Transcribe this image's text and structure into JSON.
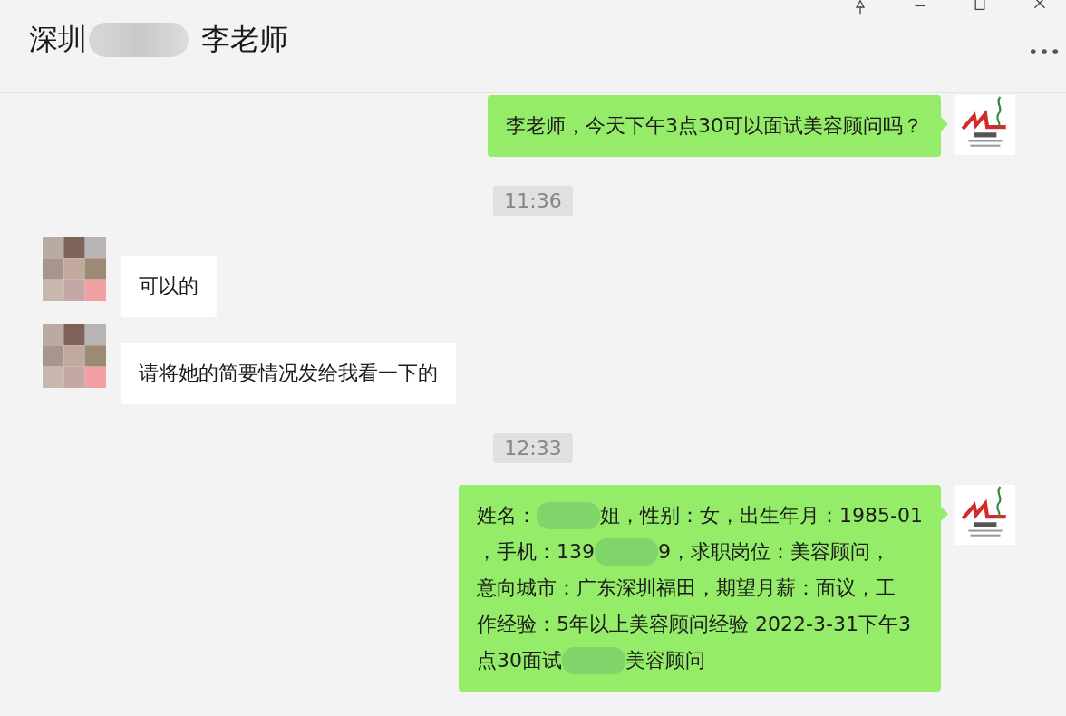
{
  "window": {
    "title_parts": [
      {
        "kind": "text",
        "text": "深圳"
      },
      {
        "kind": "blur"
      },
      {
        "kind": "text",
        "text": "李老师"
      }
    ]
  },
  "messages": [
    {
      "kind": "outgoing",
      "lines": [
        [
          {
            "kind": "text",
            "text": "李老师，今天下午3点30可以面试美容顾问吗？"
          }
        ]
      ]
    },
    {
      "kind": "time",
      "text": "11:36"
    },
    {
      "kind": "incoming",
      "lines": [
        [
          {
            "kind": "text",
            "text": "可以的"
          }
        ]
      ]
    },
    {
      "kind": "incoming",
      "lines": [
        [
          {
            "kind": "text",
            "text": "请将她的简要情况发给我看一下的"
          }
        ]
      ]
    },
    {
      "kind": "time",
      "text": "12:33"
    },
    {
      "kind": "outgoing",
      "lines": [
        [
          {
            "kind": "text",
            "text": "姓名："
          },
          {
            "kind": "blur"
          },
          {
            "kind": "text",
            "text": "姐，性别：女，出生年月：1985-01"
          }
        ],
        [
          {
            "kind": "text",
            "text": "，手机：139"
          },
          {
            "kind": "blur"
          },
          {
            "kind": "text",
            "text": "9，求职岗位：美容顾问，"
          }
        ],
        [
          {
            "kind": "text",
            "text": "意向城市：广东深圳福田，期望月薪：面议，工"
          }
        ],
        [
          {
            "kind": "text",
            "text": "作经验：5年以上美容顾问经验 2022-3-31下午3"
          }
        ],
        [
          {
            "kind": "text",
            "text": "点30面试"
          },
          {
            "kind": "blur"
          },
          {
            "kind": "text",
            "text": "美容顾问"
          }
        ]
      ]
    }
  ]
}
